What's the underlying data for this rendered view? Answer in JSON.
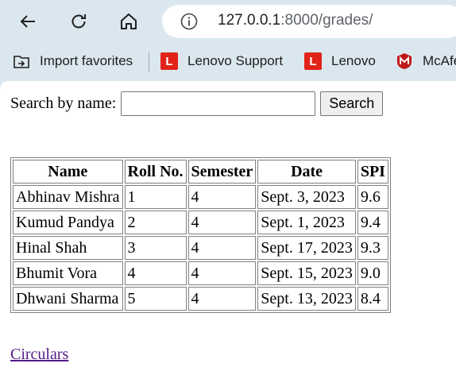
{
  "browser": {
    "url_host": "127.0.0.1",
    "url_path": ":8000/grades/",
    "icons": [
      "back-icon",
      "reload-icon",
      "home-icon",
      "info-icon"
    ],
    "favorites": [
      {
        "label": "Import favorites",
        "icon": "import-favorites-icon"
      },
      {
        "label": "Lenovo Support",
        "icon": "lenovo-logo-icon",
        "icon_letter": "L"
      },
      {
        "label": "Lenovo",
        "icon": "lenovo-logo-icon",
        "icon_letter": "L"
      },
      {
        "label": "McAfee",
        "icon": "mcafee-logo-icon"
      }
    ],
    "colors": {
      "chrome": "#dbe7ee",
      "lenovo_red": "#e2231a",
      "mcafee_red": "#c01818"
    }
  },
  "search": {
    "label": "Search by name:",
    "value": "",
    "button_label": "Search"
  },
  "grades_table": {
    "headers": [
      "Name",
      "Roll No.",
      "Semester",
      "Date",
      "SPI"
    ],
    "rows": [
      [
        "Abhinav Mishra",
        "1",
        "4",
        "Sept. 3, 2023",
        "9.6"
      ],
      [
        "Kumud Pandya",
        "2",
        "4",
        "Sept. 1, 2023",
        "9.4"
      ],
      [
        "Hinal Shah",
        "3",
        "4",
        "Sept. 17, 2023",
        "9.3"
      ],
      [
        "Bhumit Vora",
        "4",
        "4",
        "Sept. 15, 2023",
        "9.0"
      ],
      [
        "Dhwani Sharma",
        "5",
        "4",
        "Sept. 13, 2023",
        "8.4"
      ]
    ]
  },
  "footer_link": "Circulars"
}
